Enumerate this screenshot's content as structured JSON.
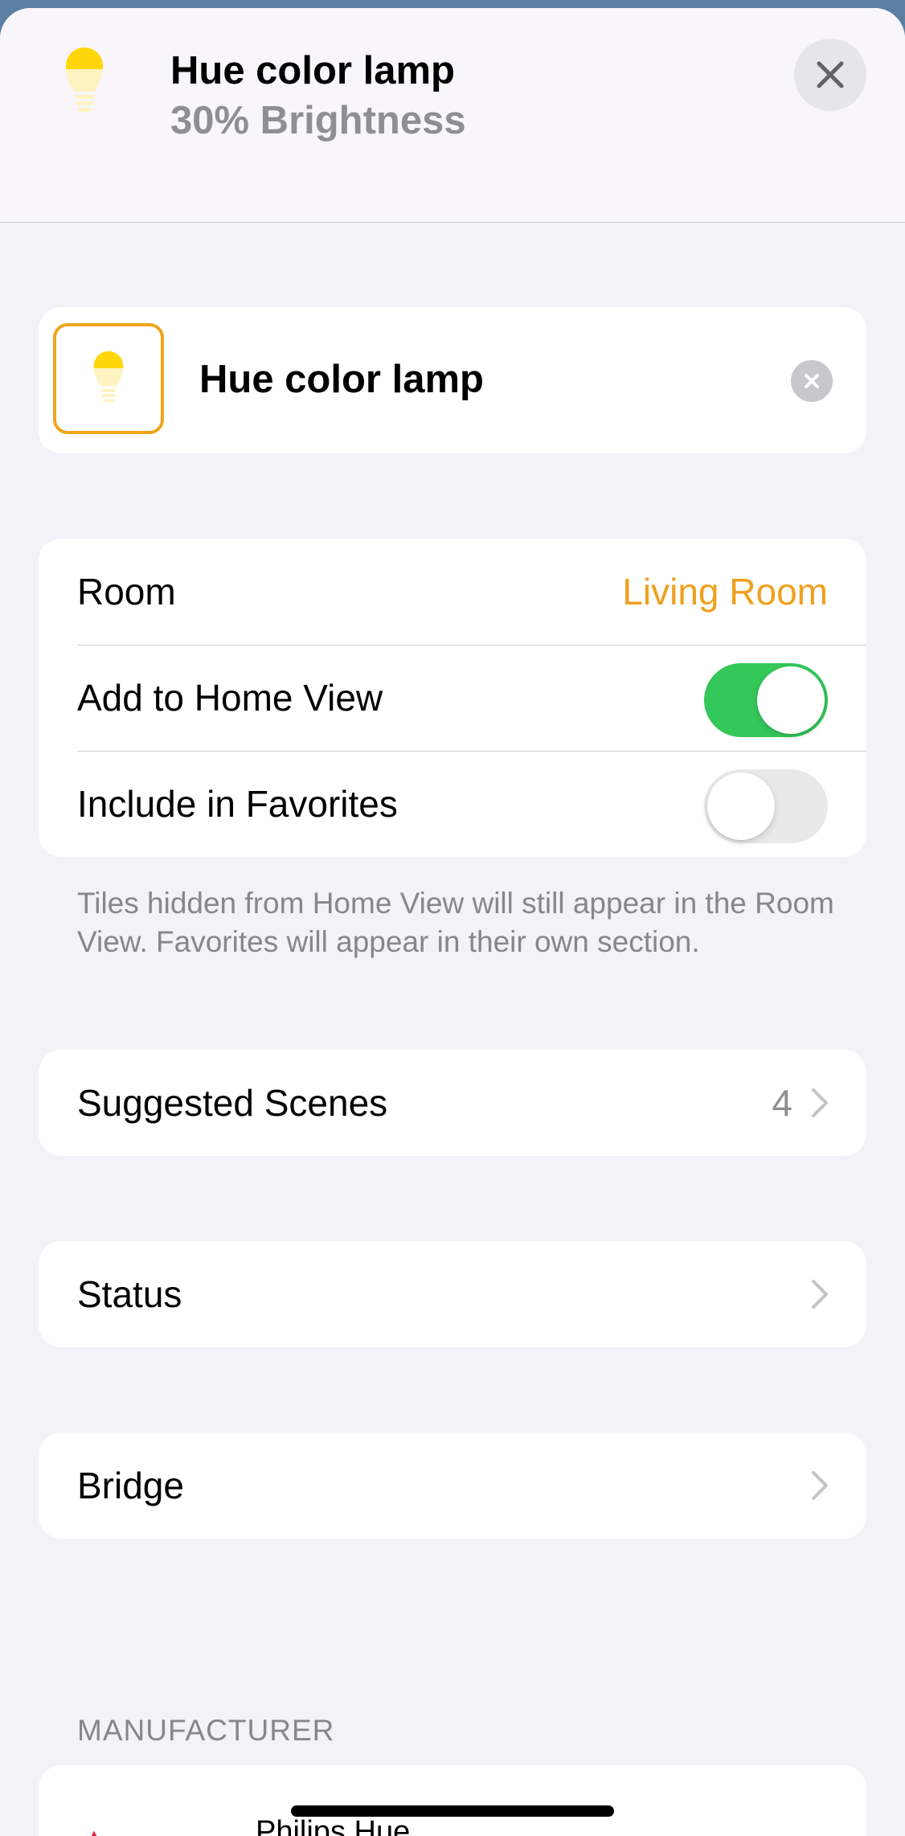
{
  "header": {
    "title": "Hue color lamp",
    "subtitle": "30% Brightness",
    "bulb_icon": "lightbulb-icon",
    "close_icon": "close-icon"
  },
  "accessory": {
    "name": "Hue color lamp",
    "icon": "lightbulb-icon",
    "clear_icon": "clear-icon"
  },
  "settings": {
    "room_label": "Room",
    "room_value": "Living Room",
    "home_view_label": "Add to Home View",
    "home_view_on": true,
    "favorites_label": "Include in Favorites",
    "favorites_on": false,
    "footnote": "Tiles hidden from Home View will still appear in the Room View. Favorites will appear in their own section."
  },
  "suggested_scenes": {
    "label": "Suggested Scenes",
    "count": "4"
  },
  "status": {
    "label": "Status"
  },
  "bridge": {
    "label": "Bridge"
  },
  "manufacturer": {
    "section_title": "MANUFACTURER",
    "name": "Philips Hue"
  },
  "colors": {
    "accent_orange": "#f0a01e",
    "toggle_on": "#34c759",
    "bulb_yellow": "#ffd60a",
    "background": "#f2f2f7"
  }
}
